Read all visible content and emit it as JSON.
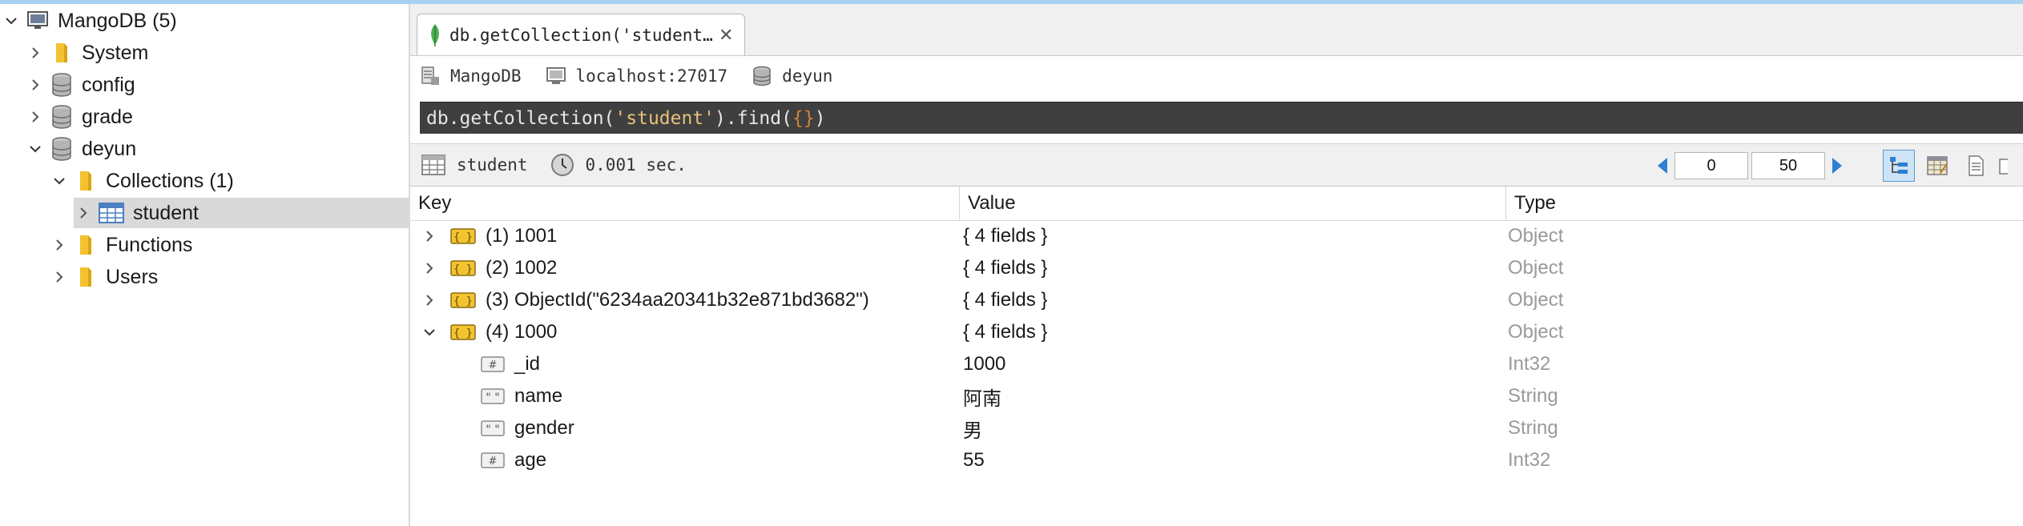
{
  "tree": {
    "root": {
      "label": "MangoDB (5)"
    },
    "items": [
      {
        "label": "System"
      },
      {
        "label": "config"
      },
      {
        "label": "grade"
      },
      {
        "label": "deyun"
      },
      {
        "label": "Collections (1)"
      },
      {
        "label": "student"
      },
      {
        "label": "Functions"
      },
      {
        "label": "Users"
      }
    ]
  },
  "tab": {
    "title": "db.getCollection('student…",
    "close": "✕"
  },
  "connection": {
    "server": "MangoDB",
    "host": "localhost:27017",
    "database": "deyun"
  },
  "query": {
    "part1": "db.getCollection(",
    "string": "'student'",
    "part2": ").find(",
    "braces": "{}",
    "part3": ")"
  },
  "status": {
    "collection": "student",
    "time": "0.001 sec."
  },
  "pager": {
    "skip": "0",
    "limit": "50"
  },
  "table": {
    "headers": {
      "key": "Key",
      "value": "Value",
      "type": "Type"
    },
    "rows": [
      {
        "key": "(1) 1001",
        "value": "{ 4 fields }",
        "type": "Object"
      },
      {
        "key": "(2) 1002",
        "value": "{ 4 fields }",
        "type": "Object"
      },
      {
        "key": "(3) ObjectId(\"6234aa20341b32e871bd3682\")",
        "value": "{ 4 fields }",
        "type": "Object"
      },
      {
        "key": "(4) 1000",
        "value": "{ 4 fields }",
        "type": "Object"
      },
      {
        "key": "_id",
        "value": "1000",
        "type": "Int32"
      },
      {
        "key": "name",
        "value": "阿南",
        "type": "String"
      },
      {
        "key": "gender",
        "value": "男",
        "type": "String"
      },
      {
        "key": "age",
        "value": "55",
        "type": "Int32"
      }
    ]
  },
  "colors": {
    "selection": "#d9d9d9",
    "query_bg": "#3f3f3f",
    "accent": "#2e7fd0",
    "folder": "#f2c230"
  },
  "icons": [
    "server-icon",
    "folder-icon",
    "database-icon",
    "collection-table-icon",
    "mongo-leaf-icon",
    "clock-icon",
    "object-icon",
    "number-type-icon",
    "string-type-icon",
    "tree-view-icon",
    "table-view-icon",
    "text-view-icon"
  ]
}
